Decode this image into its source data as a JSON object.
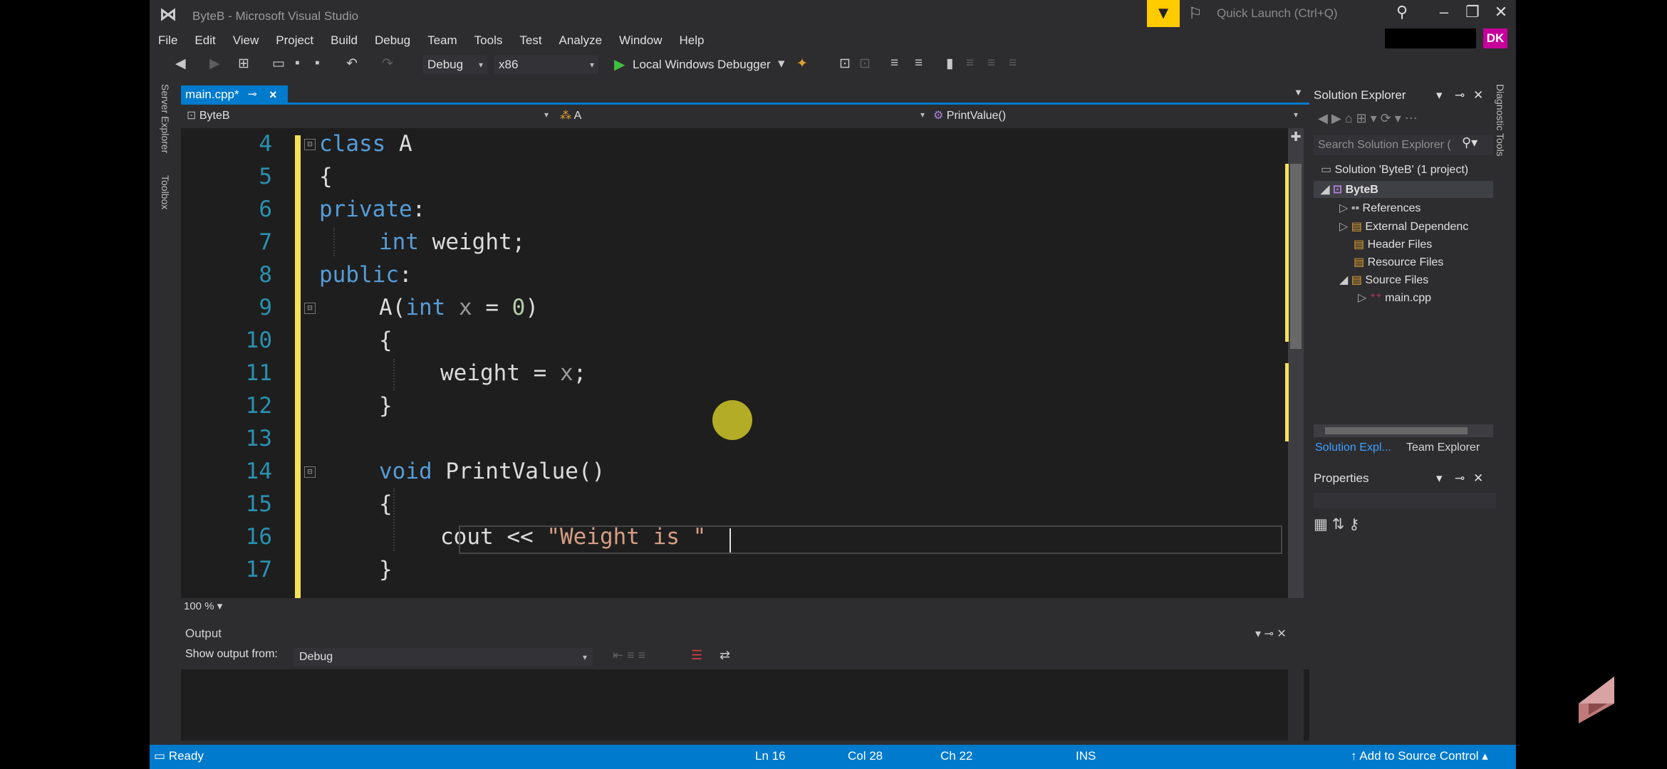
{
  "window": {
    "title": "ByteB - Microsoft Visual Studio",
    "quick_launch_placeholder": "Quick Launch (Ctrl+Q)",
    "user_badge": "DK"
  },
  "menu": [
    "File",
    "Edit",
    "View",
    "Project",
    "Build",
    "Debug",
    "Team",
    "Tools",
    "Test",
    "Analyze",
    "Window",
    "Help"
  ],
  "toolbar": {
    "configuration": "Debug",
    "platform": "x86",
    "debugger_label": "Local Windows Debugger"
  },
  "side_tabs": {
    "server_explorer": "Server Explorer",
    "toolbox": "Toolbox",
    "diagnostic_tools": "Diagnostic Tools"
  },
  "document_tab": {
    "filename": "main.cpp*"
  },
  "nav_bar": {
    "project": "ByteB",
    "scope": "A",
    "member": "PrintValue()"
  },
  "editor": {
    "zoom": "100 %",
    "line_numbers": [
      "4",
      "5",
      "6",
      "7",
      "8",
      "9",
      "10",
      "11",
      "12",
      "13",
      "14",
      "15",
      "16",
      "17"
    ],
    "code": {
      "l4_kw": "class",
      "l4_name": " A",
      "l5": "{",
      "l6_kw": "private",
      "l6_colon": ":",
      "l7_kw": "int",
      "l7_rest": " weight;",
      "l8_kw": "public",
      "l8_colon": ":",
      "l9_a": "A(",
      "l9_kw": "int",
      "l9_sp": " ",
      "l9_param": "x",
      "l9_eq": " = ",
      "l9_num": "0",
      "l9_close": ")",
      "l10": "{",
      "l11_a": "weight = ",
      "l11_param": "x",
      "l11_end": ";",
      "l12": "}",
      "l14_kw": "void",
      "l14_rest": " PrintValue()",
      "l15": "{",
      "l16_a": "cout << ",
      "l16_str": "\"Weight is \"",
      "l17": "}"
    }
  },
  "output": {
    "title": "Output",
    "show_from_label": "Show output from:",
    "show_from_value": "Debug"
  },
  "solution_explorer": {
    "title": "Solution Explorer",
    "search_placeholder": "Search Solution Explorer (",
    "solution": "Solution 'ByteB' (1 project)",
    "project": "ByteB",
    "references": "References",
    "external": "External Dependenc",
    "header_files": "Header Files",
    "resource_files": "Resource Files",
    "source_files": "Source Files",
    "main_cpp": "main.cpp",
    "tab_solution": "Solution Expl...",
    "tab_team": "Team Explorer"
  },
  "properties": {
    "title": "Properties"
  },
  "status": {
    "ready": "Ready",
    "ln": "Ln 16",
    "col": "Col 28",
    "ch": "Ch 22",
    "ins": "INS",
    "source_control": "Add to Source Control"
  },
  "colors": {
    "accent": "#007acc",
    "filter_yellow": "#ffcc00",
    "badge_magenta": "#c8009b",
    "keyword": "#569cd6",
    "line_number": "#2b91af",
    "string": "#d69d85",
    "number": "#b5cea8"
  }
}
